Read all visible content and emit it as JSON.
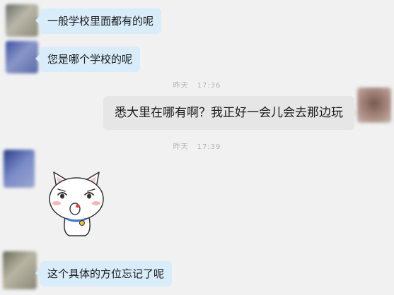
{
  "messages": [
    {
      "text": "一般学校里面都有的呢"
    },
    {
      "text": "您是哪个学校的呢"
    },
    {
      "text": "悉大里在哪有啊？我正好一会儿会去那边玩"
    },
    {
      "text": "这个具体的方位忘记了呢"
    }
  ],
  "timestamps": [
    {
      "day": "昨天",
      "time": "17:36"
    },
    {
      "day": "昨天",
      "time": "17:39"
    }
  ],
  "sticker": {
    "icon": "cartoon-cat-sticker"
  },
  "colors": {
    "incoming_bubble": "#d8ecfa",
    "outgoing_bubble": "#e6e6e6",
    "background": "#f1f1f1",
    "timestamp_text": "#b4b4b4"
  }
}
